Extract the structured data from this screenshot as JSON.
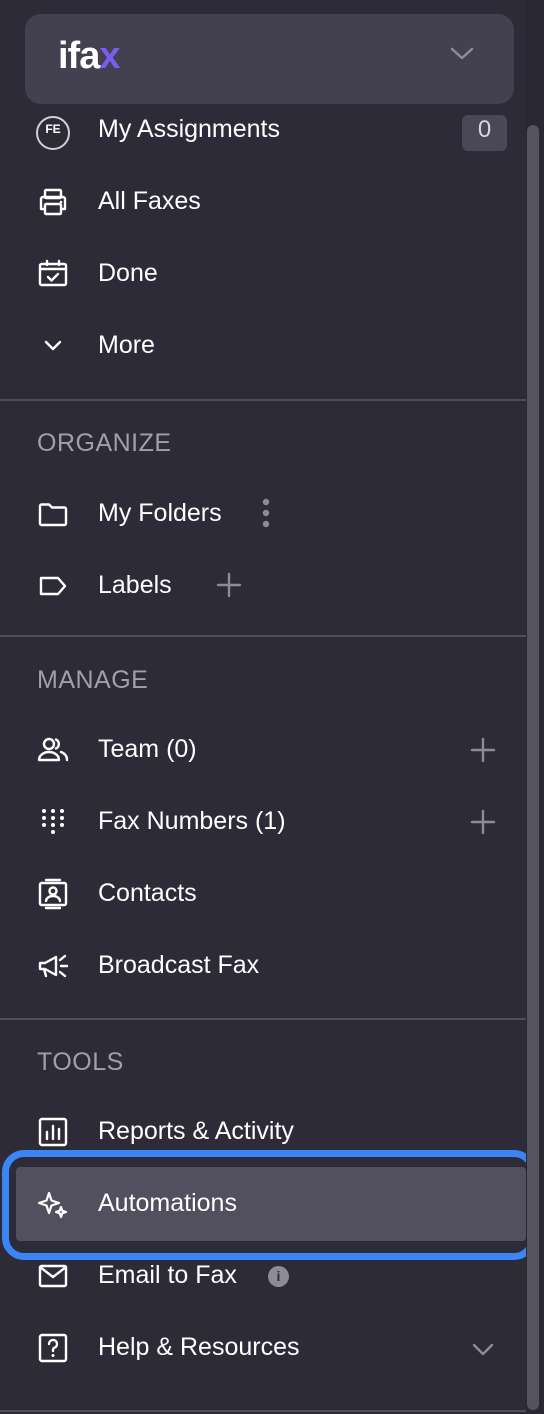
{
  "brand": {
    "logo_main": "ifa",
    "logo_accent": "x"
  },
  "account": {
    "avatar_initials": "FE"
  },
  "primary_nav": [
    {
      "label": "My Assignments",
      "icon": "avatar-icon",
      "badge": "0"
    },
    {
      "label": "All Faxes",
      "icon": "printer-icon"
    },
    {
      "label": "Done",
      "icon": "calendar-check-icon"
    },
    {
      "label": "More",
      "icon": "chevron-down-icon"
    }
  ],
  "sections": {
    "organize": {
      "title": "ORGANIZE",
      "items": [
        {
          "label": "My Folders",
          "icon": "folder-icon"
        },
        {
          "label": "Labels",
          "icon": "label-tag-icon"
        }
      ]
    },
    "manage": {
      "title": "MANAGE",
      "items": [
        {
          "label": "Team (0)",
          "icon": "team-icon"
        },
        {
          "label": "Fax Numbers (1)",
          "icon": "dialpad-icon"
        },
        {
          "label": "Contacts",
          "icon": "contact-card-icon"
        },
        {
          "label": "Broadcast Fax",
          "icon": "megaphone-icon"
        }
      ]
    },
    "tools": {
      "title": "TOOLS",
      "items": [
        {
          "label": "Reports & Activity",
          "icon": "report-chart-icon"
        },
        {
          "label": "Automations",
          "icon": "sparkle-icon",
          "highlighted": true
        },
        {
          "label": "Email to Fax",
          "icon": "envelope-icon",
          "info": "i"
        },
        {
          "label": "Help & Resources",
          "icon": "help-square-icon"
        }
      ]
    }
  },
  "colors": {
    "sidebar_bg": "#2d2b38",
    "header_bg": "#43414f",
    "highlight_border": "#3a86f7",
    "active_bg": "#524f5e",
    "section_text": "#a19fac"
  }
}
